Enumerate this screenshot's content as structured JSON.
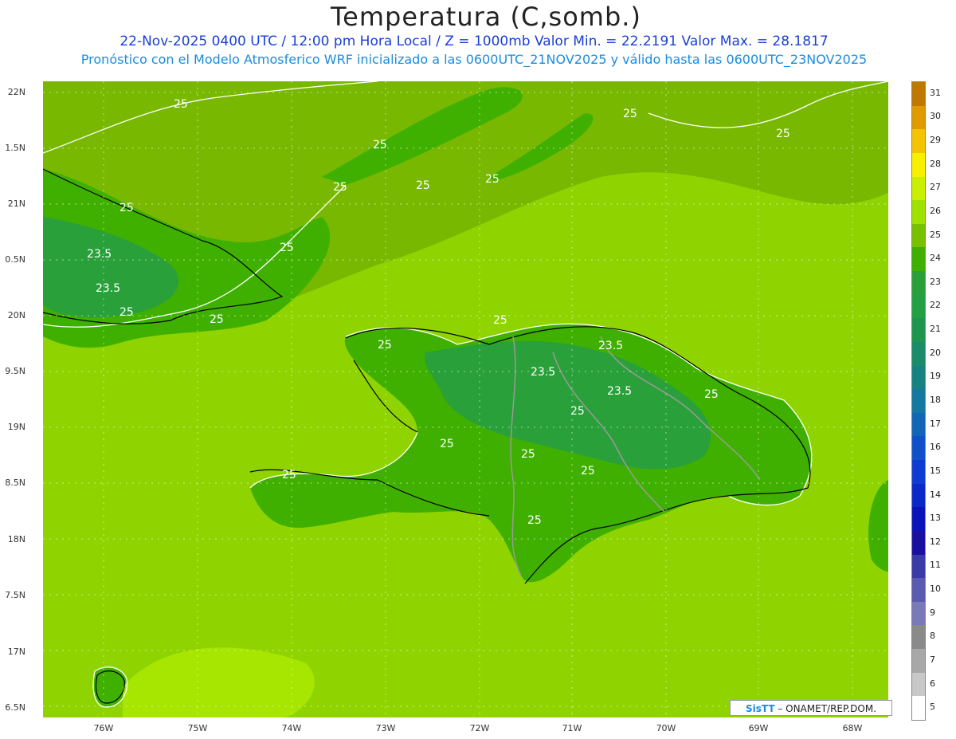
{
  "header": {
    "title": "Temperatura (C,somb.)",
    "line1": "22-Nov-2025 0400 UTC / 12:00 pm Hora Local / Z = 1000mb   Valor Min. = 22.2191  Valor Max. = 28.1817",
    "line2": "Pronóstico con el Modelo Atmosferico WRF inicializado a las 0600UTC_21NOV2025 y válido hasta las  0600UTC_23NOV2025"
  },
  "axes": {
    "y_labels": [
      "22N",
      "1.5N",
      "21N",
      "0.5N",
      "20N",
      "9.5N",
      "19N",
      "8.5N",
      "18N",
      "7.5N",
      "17N",
      "6.5N"
    ],
    "x_labels": [
      "76W",
      "75W",
      "74W",
      "73W",
      "72W",
      "71W",
      "70W",
      "69W",
      "68W"
    ]
  },
  "contours": {
    "labels": [
      "25",
      "25",
      "25",
      "25",
      "25",
      "25",
      "25",
      "25",
      "23.5",
      "23.5",
      "25",
      "25",
      "25",
      "25",
      "23.5",
      "23.5",
      "25",
      "25",
      "25",
      "25",
      "23.5",
      "25",
      "25",
      "25",
      "25"
    ]
  },
  "colorbar": {
    "labels": [
      "31",
      "30",
      "29",
      "28",
      "27",
      "26",
      "25",
      "24",
      "23",
      "22",
      "21",
      "20",
      "19",
      "18",
      "17",
      "16",
      "15",
      "14",
      "13",
      "12",
      "11",
      "10",
      "9",
      "8",
      "7",
      "6",
      "5"
    ],
    "colors": [
      "#c07800",
      "#e09a00",
      "#f5c400",
      "#f7f000",
      "#c8f000",
      "#9ee000",
      "#78c000",
      "#3fb000",
      "#2aa03a",
      "#24a044",
      "#1e9650",
      "#1a8c6a",
      "#168282",
      "#1478a0",
      "#1266b8",
      "#1050c8",
      "#0e3cd0",
      "#0c28c8",
      "#0a14b8",
      "#1a10a0",
      "#3a3aa8",
      "#5a5ab0",
      "#7a7ab8",
      "#8a8a8a",
      "#a8a8a8",
      "#c8c8c8",
      "#ffffff"
    ]
  },
  "credit": {
    "logo": "SisTT",
    "text": " – ONAMET/REP.DOM."
  }
}
